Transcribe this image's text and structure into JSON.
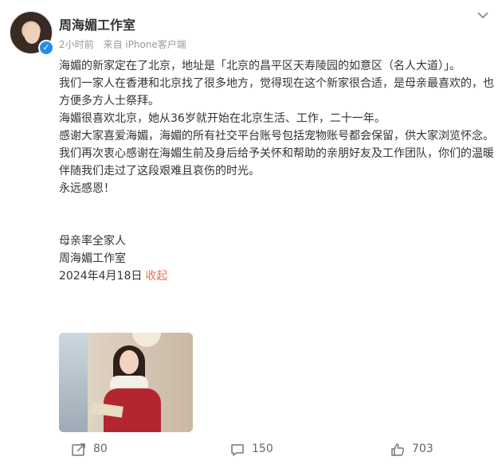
{
  "post": {
    "author": "周海媚工作室",
    "time_ago": "2小时前",
    "source": "来自 iPhone客户端",
    "paragraphs": [
      "海媚的新家定在了北京，地址是「北京的昌平区天寿陵园的如意区（名人大道）」。",
      "我们一家人在香港和北京找了很多地方，觉得现在这个新家很合适，是母亲最喜欢的，也方便多方人士祭拜。",
      "海媚很喜欢北京，她从36岁就开始在北京生活、工作，二十一年。",
      "感谢大家喜爱海媚，海媚的所有社交平台账号包括宠物账号都会保留，供大家浏览怀念。",
      "我们再次衷心感谢在海媚生前及身后给予关怀和帮助的亲朋好友及工作团队，你们的温暖伴随我们走过了这段艰难且哀伤的时光。",
      "永远感恩！"
    ],
    "signature_1": "母亲率全家人",
    "signature_2": "周海媚工作室",
    "date": "2024年4月18日",
    "collapse": "收起"
  },
  "actions": {
    "repost": "80",
    "comment": "150",
    "like": "703"
  },
  "icons": {
    "verified": "verified-badge-icon",
    "more": "chevron-down-icon",
    "repost": "repost-icon",
    "comment": "comment-icon",
    "like": "thumbs-up-icon"
  },
  "colors": {
    "accent": "#eb7350",
    "verified": "#1e8ef0"
  }
}
